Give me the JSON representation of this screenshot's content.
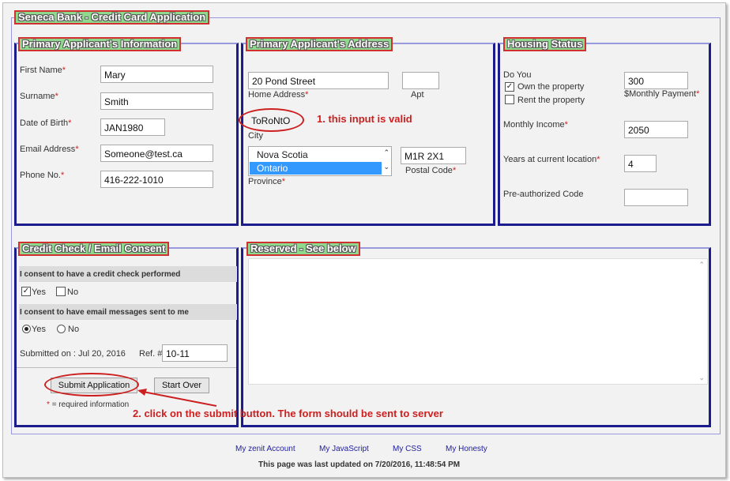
{
  "form_title": "Seneca Bank - Credit Card Application",
  "primary_info": {
    "legend": "Primary Applicant's Information",
    "first_name_label": "First Name",
    "first_name": "Mary",
    "surname_label": "Surname",
    "surname": "Smith",
    "dob_label": "Date of Birth",
    "dob": "JAN1980",
    "email_label": "Email Address",
    "email": "Someone@test.ca",
    "phone_label": "Phone No.",
    "phone": "416-222-1010"
  },
  "address": {
    "legend": "Primary Applicant's Address",
    "street": "20 Pond Street",
    "home_address_label": "Home Address",
    "apt": "",
    "apt_label": "Apt",
    "city": "ToRoNtO",
    "city_label": "City",
    "provinces": [
      "Nova Scotia",
      "Ontario"
    ],
    "selected_province": "Ontario",
    "province_label": "Province",
    "postal_code": "M1R 2X1",
    "postal_code_label": "Postal Code"
  },
  "housing": {
    "legend": "Housing Status",
    "do_you_label": "Do You",
    "own_label": "Own the property",
    "own_checked": true,
    "rent_label": "Rent the property",
    "rent_checked": false,
    "monthly_payment": "300",
    "monthly_payment_label": "$Monthly Payment",
    "monthly_income_label": "Monthly Income",
    "monthly_income": "2050",
    "years_label": "Years at current location",
    "years": "4",
    "preauth_label": "Pre-authorized Code",
    "preauth_code": ""
  },
  "credit": {
    "legend": "Credit Check / Email Consent",
    "credit_question": "I consent to have a credit check performed",
    "yes_label": "Yes",
    "no_label": "No",
    "credit_yes_checked": true,
    "email_question": "I consent to have email messages sent to me",
    "email_yes_selected": true,
    "submitted_on": "Submitted on : Jul 20, 2016",
    "ref_label": "Ref. #",
    "ref_value": "10-11",
    "submit_label": "Submit Application",
    "start_over_label": "Start Over",
    "required_note": "= required information"
  },
  "reserved": {
    "legend": "Reserved - See below"
  },
  "annotations": {
    "valid_note": "1. this input is valid",
    "submit_note": "2. click on the submit button. The form should be sent to server"
  },
  "footer": {
    "links": [
      "My zenit Account",
      "My JavaScript",
      "My CSS",
      "My Honesty"
    ],
    "updated": "This page was last updated on 7/20/2016, 11:48:54 PM"
  },
  "colors": {
    "panel_border": "#1c1c8c",
    "legend_bg": "#8fd98f",
    "annotation": "#cc2020"
  }
}
